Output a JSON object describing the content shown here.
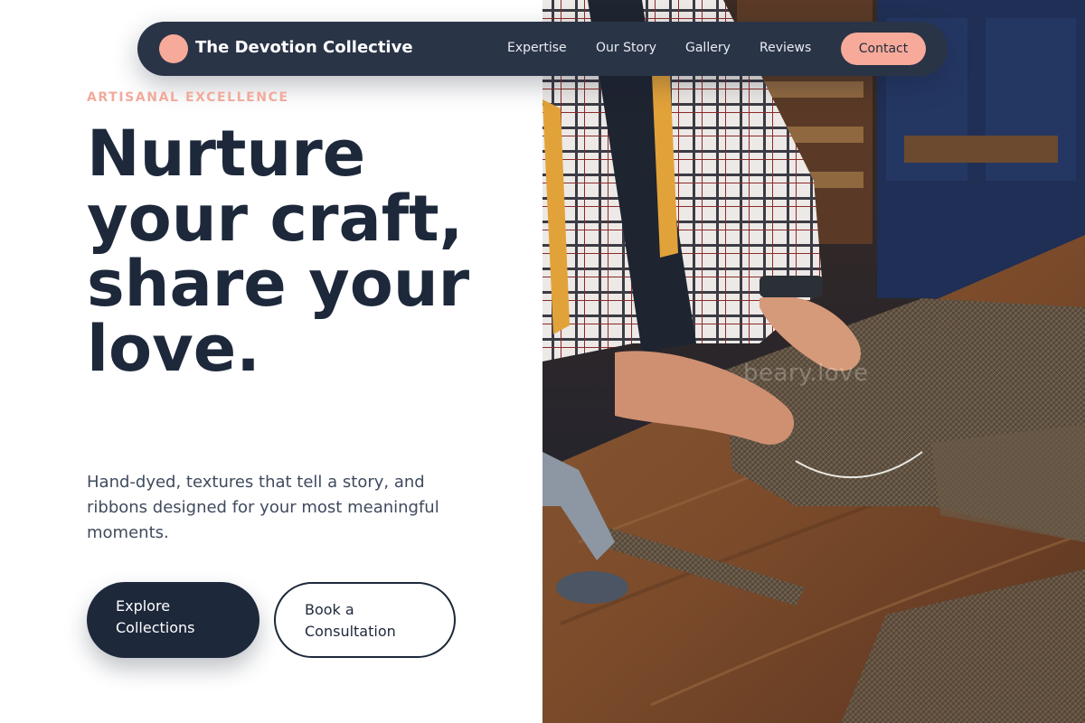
{
  "navbar": {
    "brand": "The Devotion Collective",
    "links": [
      "Expertise",
      "Our Story",
      "Gallery",
      "Reviews"
    ],
    "contact_label": "Contact"
  },
  "hero": {
    "eyebrow": "ARTISANAL EXCELLENCE",
    "headline": "Nurture your craft, share your love.",
    "description": "Hand-dyed, textures that tell a story, and ribbons designed for your most meaningful moments.",
    "primary_cta": "Explore Collections",
    "secondary_cta": "Book a Consultation"
  },
  "photo": {
    "watermark": "beary.love",
    "subject": "tailor cutting tweed fabric on a wooden workbench"
  },
  "colors": {
    "navy": "#1d283b",
    "accent_peach": "#f7aa9a",
    "nav_bg": "#2a3447"
  }
}
